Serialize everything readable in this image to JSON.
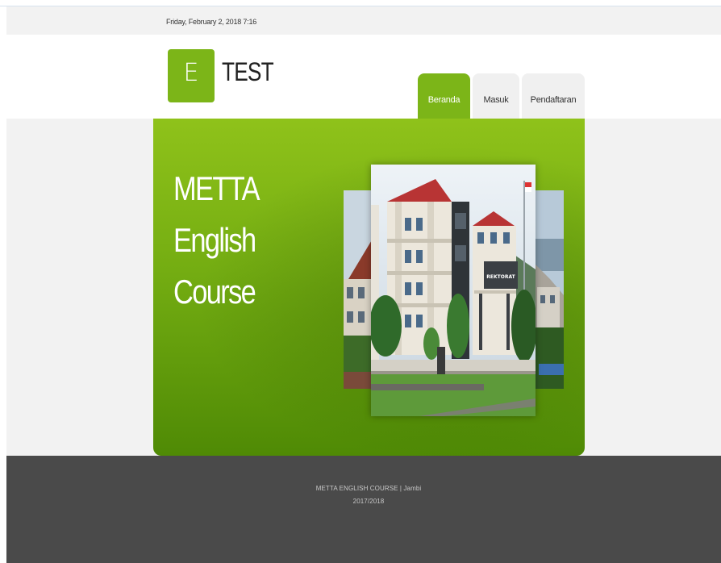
{
  "datebar": {
    "text": "Friday, February 2, 2018   7:16"
  },
  "logo": {
    "letter": "E",
    "text": "TEST",
    "color": "#7cb518"
  },
  "nav": {
    "tabs": [
      {
        "label": "Beranda",
        "active": true
      },
      {
        "label": "Masuk",
        "active": false
      },
      {
        "label": "Pendaftaran",
        "active": false
      }
    ]
  },
  "hero": {
    "lines": [
      "METTA",
      "English",
      "Course"
    ],
    "accent": "#7cb518",
    "image": {
      "sign": "REKTORAT"
    }
  },
  "footer": {
    "line1": "METTA ENGLISH COURSE | Jambi",
    "line2": "2017/2018",
    "background": "#4a4a4a"
  }
}
